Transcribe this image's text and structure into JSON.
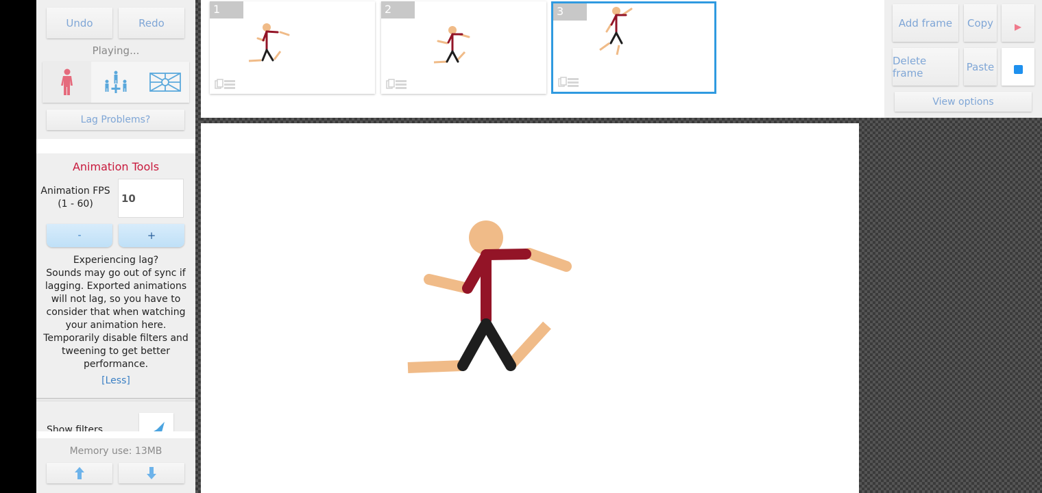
{
  "sidebar": {
    "undo_label": "Undo",
    "redo_label": "Redo",
    "status_text": "Playing...",
    "tool_icons": [
      "stickfigure-icon",
      "multi-figure-move-icon",
      "background-scene-icon"
    ],
    "lag_problems_label": "Lag Problems?",
    "animation_tools": {
      "title": "Animation Tools",
      "fps_label_line1": "Animation FPS",
      "fps_label_line2": "(1 - 60)",
      "fps_value": "10",
      "decrement_label": "-",
      "increment_label": "+",
      "lag_info_lines": [
        "Experiencing lag?",
        "Sounds may go out of sync if",
        "lagging. Exported animations",
        "will not lag, so you have to",
        "consider that when watching",
        "your animation here.",
        "Temporarily disable filters and",
        "tweening to get better",
        "performance."
      ],
      "less_link": "[Less]"
    },
    "show_filters_label": "Show filters",
    "show_filters_checked": true,
    "memory_text": "Memory use: 13MB",
    "scroll_up_icon": "arrow-up-icon",
    "scroll_down_icon": "arrow-down-icon"
  },
  "timeline": {
    "frames": [
      {
        "number": "1",
        "selected": false
      },
      {
        "number": "2",
        "selected": false
      },
      {
        "number": "3",
        "selected": true
      }
    ]
  },
  "frame_controls": {
    "add_frame_label": "Add frame",
    "copy_label": "Copy",
    "delete_frame_label": "Delete frame",
    "paste_label": "Paste",
    "view_options_label": "View options",
    "play_icon": "play-icon",
    "stop_icon": "stop-icon"
  },
  "colors": {
    "accent_red": "#c8193c",
    "link_blue": "#3a7fc4",
    "selected_frame_border": "#2f9ae0",
    "figure_skin": "#f0bb88",
    "figure_shirt": "#931427",
    "figure_pants": "#1e1e1e"
  }
}
